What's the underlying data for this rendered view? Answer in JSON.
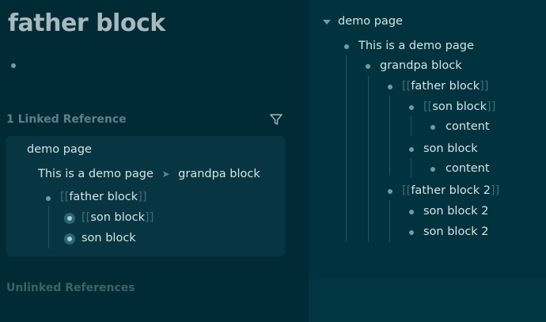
{
  "left": {
    "title": "father block",
    "linked_header": "1 Linked Reference",
    "reference": {
      "page": "demo page",
      "breadcrumb": [
        "This is a demo page",
        "grandpa block"
      ],
      "breadcrumb_sep": "➤",
      "father_label": "father block",
      "son_ref_label": "son block",
      "son_label": "son block"
    },
    "unlinked_header": "Unlinked References"
  },
  "right": {
    "page": "demo page",
    "items": {
      "demo_line": "This is a demo page",
      "grandpa": "grandpa block",
      "father": "father block",
      "son_ref": "son block",
      "content_1": "content",
      "son": "son block",
      "content_2": "content",
      "father2": "father block 2",
      "son2_a": "son block 2",
      "son2_b": "son block 2"
    }
  },
  "brackets": {
    "open": "[[",
    "close": "]]"
  },
  "colors": {
    "bg_left": "#002b36",
    "bg_right": "#01333f",
    "card": "#073642",
    "bullet": "#6f9da2",
    "bracket": "#3f6f78"
  }
}
